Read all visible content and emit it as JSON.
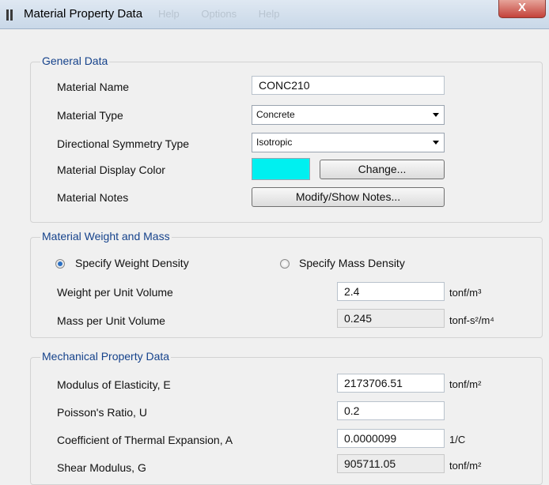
{
  "window": {
    "title": "Material Property Data",
    "ghost_menu": "Help  Options  Help",
    "close_label": "X"
  },
  "general": {
    "legend": "General Data",
    "name_label": "Material Name",
    "name_value": "CONC210",
    "type_label": "Material Type",
    "type_value": "Concrete",
    "symmetry_label": "Directional Symmetry Type",
    "symmetry_value": "Isotropic",
    "color_label": "Material Display Color",
    "color_hex": "#00f0f0",
    "change_button": "Change...",
    "notes_label": "Material Notes",
    "notes_button": "Modify/Show Notes..."
  },
  "weight": {
    "legend": "Material Weight and Mass",
    "radio_weight": "Specify Weight Density",
    "radio_mass": "Specify Mass Density",
    "selected": "weight",
    "wpv_label": "Weight per Unit Volume",
    "wpv_value": "2.4",
    "wpv_unit": "tonf/m³",
    "mpv_label": "Mass per Unit Volume",
    "mpv_value": "0.245",
    "mpv_unit": "tonf-s²/m⁴"
  },
  "mech": {
    "legend": "Mechanical Property Data",
    "e_label": "Modulus of Elasticity,  E",
    "e_value": "2173706.51",
    "e_unit": "tonf/m²",
    "u_label": "Poisson's Ratio,  U",
    "u_value": "0.2",
    "a_label": "Coefficient of Thermal Expansion,  A",
    "a_value": "0.0000099",
    "a_unit": "1/C",
    "g_label": "Shear Modulus,  G",
    "g_value": "905711.05",
    "g_unit": "tonf/m²"
  }
}
